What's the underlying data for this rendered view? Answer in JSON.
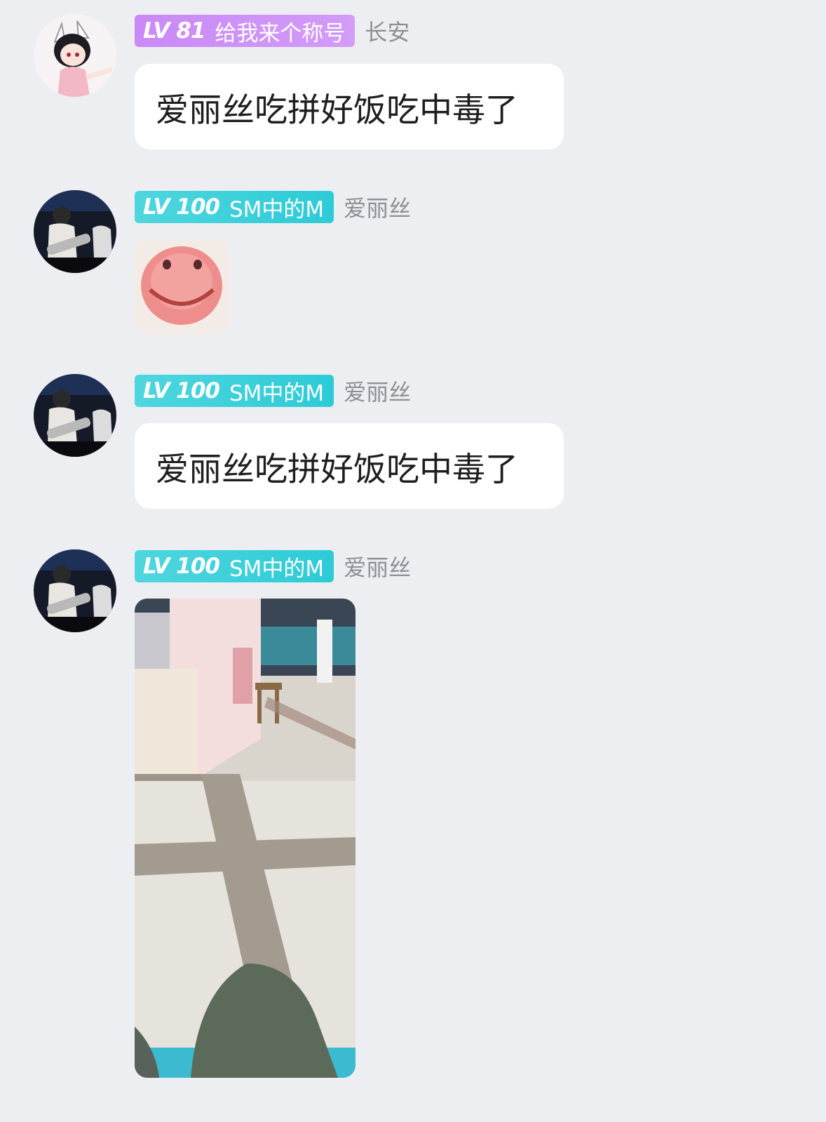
{
  "messages": [
    {
      "level": "LV 81",
      "title": "给我来个称号",
      "sender": "长安",
      "text": "爱丽丝吃拼好饭吃中毒了",
      "badge_color": "#c989f7"
    },
    {
      "level": "LV 100",
      "title": "SM中的M",
      "sender": "爱丽丝",
      "content": "sticker-image",
      "badge_color": "#2ccbd6"
    },
    {
      "level": "LV 100",
      "title": "SM中的M",
      "sender": "爱丽丝",
      "text": "爱丽丝吃拼好饭吃中毒了",
      "badge_color": "#2ccbd6"
    },
    {
      "level": "LV 100",
      "title": "SM中的M",
      "sender": "爱丽丝",
      "content": "photo-image",
      "badge_color": "#2ccbd6"
    }
  ]
}
